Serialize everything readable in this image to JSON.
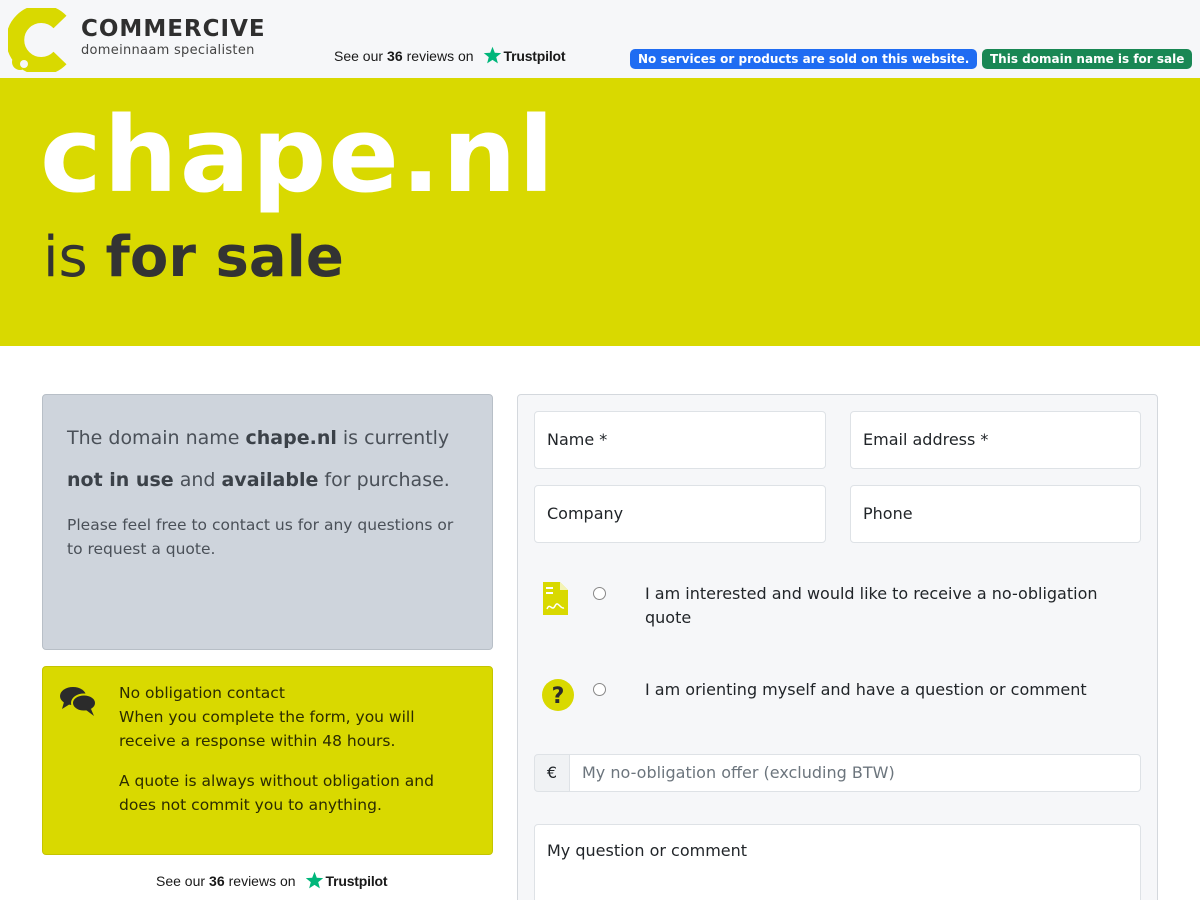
{
  "header": {
    "brand_name": "COMMERCIVE",
    "brand_tagline": "domeinnaam specialisten",
    "trustpilot": {
      "prefix": "See our",
      "count": "36",
      "suffix": "reviews on",
      "brand": "Trustpilot"
    },
    "badge_no_sales": "No services or products are sold on this website.",
    "badge_for_sale": "This domain name is for sale"
  },
  "hero": {
    "domain": "chape.nl",
    "is": "is",
    "for_sale": "for sale"
  },
  "info": {
    "part1": "The domain name ",
    "domain": "chape.nl",
    "part2": " is currently ",
    "not_in_use": "not in use",
    "part3": " and ",
    "available": "available",
    "part4": " for purchase.",
    "sub": "Please feel free to contact us for any questions or to request a quote."
  },
  "contact": {
    "title": "No obligation contact",
    "response": "When you complete the form, you will receive a response within 48 hours.",
    "quote": "A quote is always without obligation and does not commit you to anything."
  },
  "form": {
    "name_placeholder": "Name *",
    "email_placeholder": "Email address *",
    "company_placeholder": "Company",
    "phone_placeholder": "Phone",
    "option_quote": "I am interested and would like to receive a no-obligation quote",
    "option_question": "I am orienting myself and have a question or comment",
    "currency": "€",
    "offer_placeholder": "My no-obligation offer (excluding BTW)",
    "question_placeholder": "My question or comment"
  },
  "colors": {
    "brand_yellow": "#d9d900",
    "badge_blue": "#1f6cf2",
    "badge_green": "#198754",
    "trustpilot_green": "#00b67a"
  }
}
